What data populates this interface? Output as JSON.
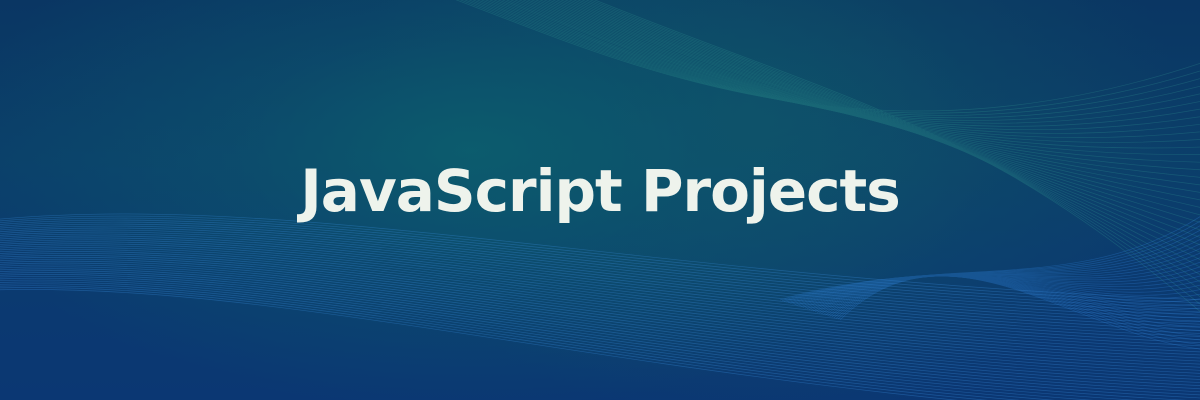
{
  "banner": {
    "title": "JavaScript Projects"
  },
  "colors": {
    "background_dark": "#0a3663",
    "background_teal": "#0c606e",
    "line_teal": "#3fb8a0",
    "line_blue": "#3a8fe0",
    "title_text": "#eef3ec"
  }
}
